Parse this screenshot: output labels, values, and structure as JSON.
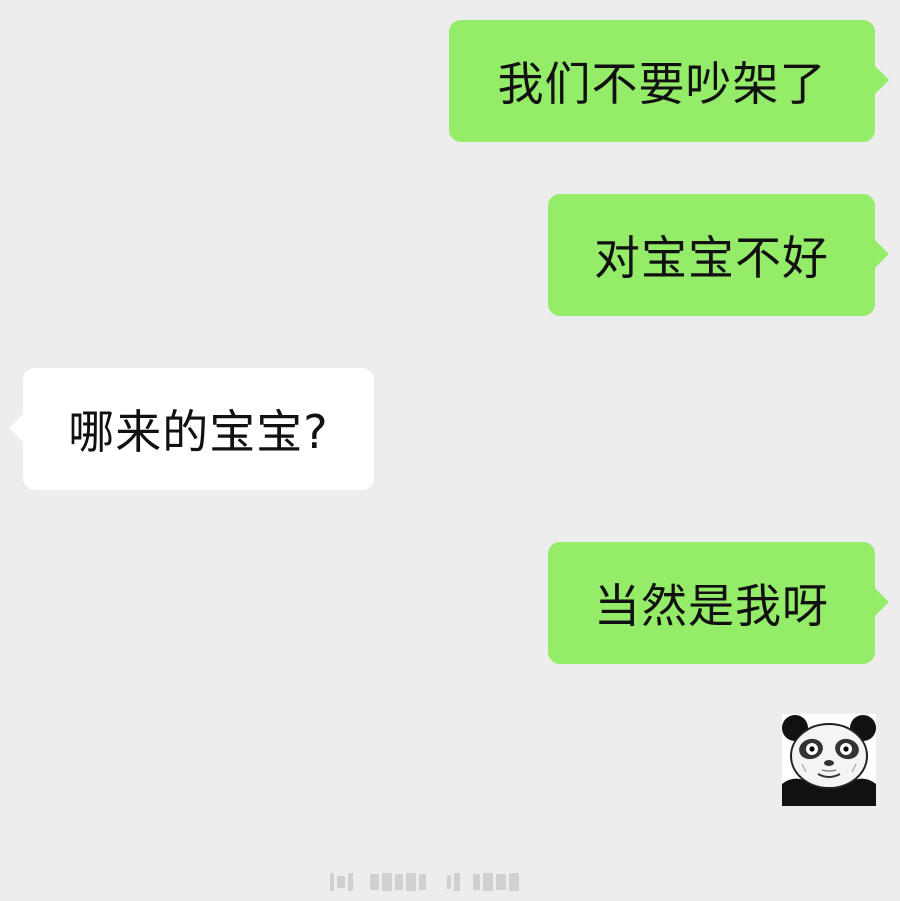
{
  "messages": [
    {
      "side": "out",
      "text": "我们不要吵架了"
    },
    {
      "side": "out",
      "text": "对宝宝不好"
    },
    {
      "side": "in",
      "text": "哪来的宝宝?"
    },
    {
      "side": "out",
      "text": "当然是我呀"
    }
  ],
  "sticker": {
    "icon": "panda-meme-icon"
  },
  "colors": {
    "background": "#ededed",
    "outgoing_bubble": "#95ec69",
    "incoming_bubble": "#ffffff",
    "text": "#111111"
  }
}
